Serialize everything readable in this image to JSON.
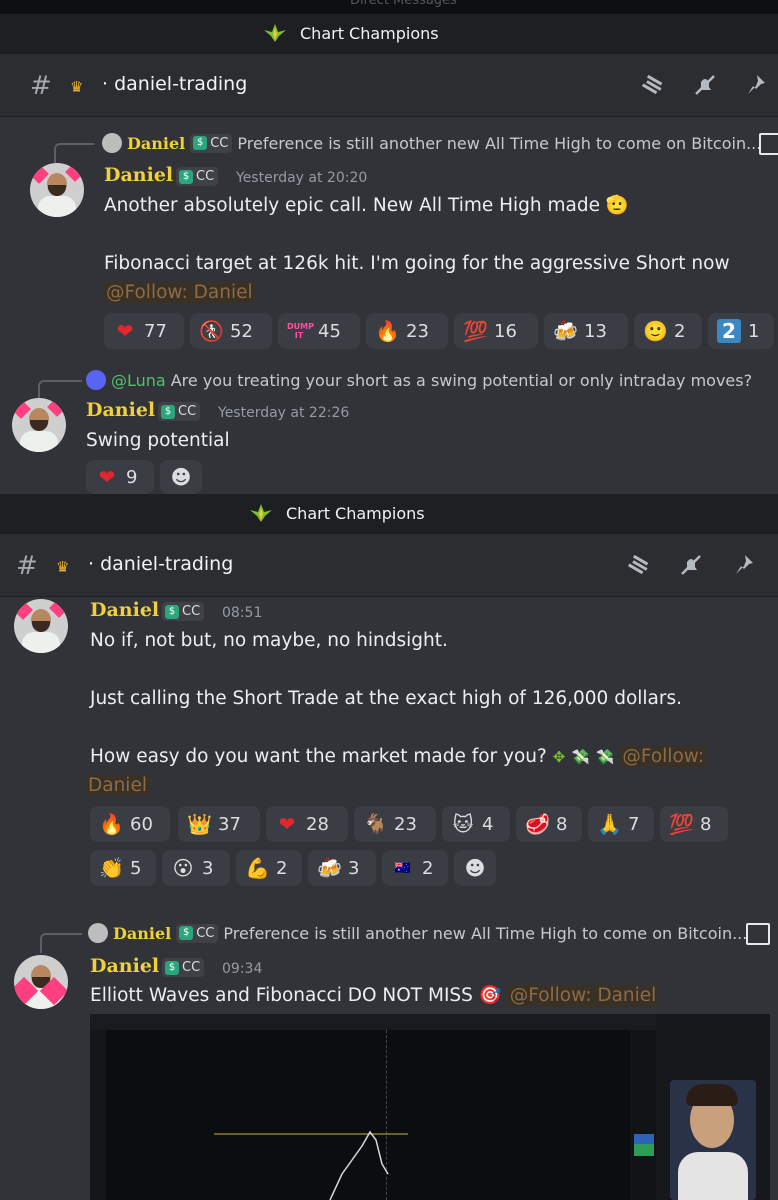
{
  "top_bar": {
    "label": "Direct Messages"
  },
  "server": {
    "name": "Chart Champions"
  },
  "channel": {
    "name": "· daniel-trading"
  },
  "post1": {
    "reply": {
      "user": "Daniel",
      "badge": "CC",
      "text": "Preference is still another new All Time High to come on Bitcoin..."
    },
    "user": "Daniel",
    "badge": "CC",
    "time": "Yesterday at 20:20",
    "lines": [
      "Another absolutely epic call. New All Time High made",
      "Fibonacci target at 126k hit. I'm going for the aggressive Short now"
    ],
    "mention": "@Follow: Daniel",
    "reactions": [
      {
        "icon": "heart",
        "glyph": "❤",
        "count": "77"
      },
      {
        "icon": "person-slash",
        "glyph": "🚷",
        "count": "52"
      },
      {
        "icon": "dump-it",
        "glyph": "DUMP IT",
        "count": "45"
      },
      {
        "icon": "fire",
        "glyph": "🔥",
        "count": "23"
      },
      {
        "icon": "hundred",
        "glyph": "💯",
        "count": "16"
      },
      {
        "icon": "beers",
        "glyph": "🍻",
        "count": "13"
      },
      {
        "icon": "smile",
        "glyph": "🙂",
        "count": "2"
      },
      {
        "icon": "two",
        "glyph": "2",
        "count": "1"
      }
    ]
  },
  "post2": {
    "reply": {
      "user": "@Luna",
      "text": "Are you treating your short as a swing potential or only intraday moves?"
    },
    "user": "Daniel",
    "badge": "CC",
    "time": "Yesterday at 22:26",
    "text": "Swing potential",
    "reactions": [
      {
        "icon": "heart",
        "glyph": "❤",
        "count": "9"
      }
    ]
  },
  "post3": {
    "user": "Daniel",
    "badge": "CC",
    "time": "08:51",
    "lines": [
      "No if, not but, no maybe, no hindsight.",
      "Just calling the Short Trade at the exact high of 126,000 dollars.",
      "How easy do you want the market made for you?"
    ],
    "mention_a": "@Follow:",
    "mention_b": "Daniel",
    "reactions": [
      {
        "icon": "fire",
        "glyph": "🔥",
        "count": "60"
      },
      {
        "icon": "crown",
        "glyph": "👑",
        "count": "37"
      },
      {
        "icon": "heart",
        "glyph": "❤",
        "count": "28"
      },
      {
        "icon": "goat",
        "glyph": "🐐",
        "count": "23"
      },
      {
        "icon": "cat",
        "glyph": "🐱",
        "count": "4"
      },
      {
        "icon": "meat",
        "glyph": "🥩",
        "count": "8"
      },
      {
        "icon": "pray",
        "glyph": "🙏",
        "count": "7"
      },
      {
        "icon": "hundred",
        "glyph": "💯",
        "count": "8"
      },
      {
        "icon": "clap",
        "glyph": "👏",
        "count": "5"
      },
      {
        "icon": "face",
        "glyph": "😮",
        "count": "3"
      },
      {
        "icon": "muscle",
        "glyph": "💪",
        "count": "2"
      },
      {
        "icon": "beers",
        "glyph": "🍻",
        "count": "3"
      },
      {
        "icon": "flag-australia",
        "glyph": "🇦🇺",
        "count": "2"
      }
    ]
  },
  "post4": {
    "reply": {
      "user": "Daniel",
      "badge": "CC",
      "text": "Preference is still another new All Time High to come on Bitcoin..."
    },
    "user": "Daniel",
    "badge": "CC",
    "time": "09:34",
    "text": "Elliott Waves and Fibonacci DO NOT MISS",
    "mention": "@Follow: Daniel"
  },
  "colors": {
    "accent_name": "#f0d13c",
    "background": "#313338",
    "reaction_bg": "#3b3d44"
  }
}
